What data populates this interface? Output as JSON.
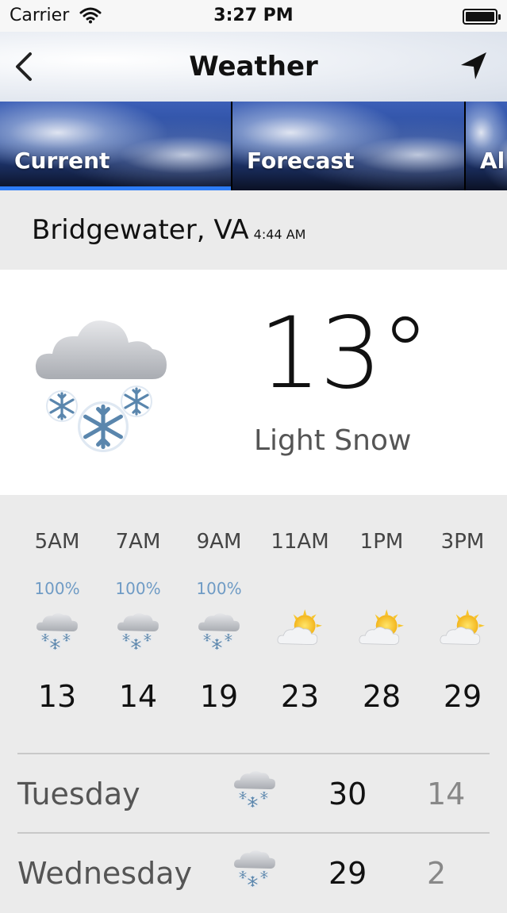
{
  "status_bar": {
    "carrier": "Carrier",
    "time": "3:27 PM"
  },
  "nav": {
    "title": "Weather",
    "back_icon": "chevron-left-icon",
    "location_icon": "location-arrow-icon"
  },
  "tabs": [
    {
      "label": "Current",
      "selected": true
    },
    {
      "label": "Forecast",
      "selected": false
    },
    {
      "label": "Al",
      "selected": false
    }
  ],
  "accent_color": "#2d7cf6",
  "location": {
    "city": "Bridgewater, VA",
    "time": "4:44 AM"
  },
  "current": {
    "temperature": "13°",
    "condition": "Light Snow",
    "icon": "snow-cloud-icon"
  },
  "hourly": [
    {
      "time": "5AM",
      "pop": "100%",
      "icon": "snow-cloud-icon",
      "temp": "13"
    },
    {
      "time": "7AM",
      "pop": "100%",
      "icon": "snow-cloud-icon",
      "temp": "14"
    },
    {
      "time": "9AM",
      "pop": "100%",
      "icon": "snow-cloud-icon",
      "temp": "19"
    },
    {
      "time": "11AM",
      "pop": "",
      "icon": "partly-sunny-icon",
      "temp": "23"
    },
    {
      "time": "1PM",
      "pop": "",
      "icon": "partly-sunny-icon",
      "temp": "28"
    },
    {
      "time": "3PM",
      "pop": "",
      "icon": "partly-sunny-icon",
      "temp": "29"
    }
  ],
  "daily": [
    {
      "day": "Tuesday",
      "icon": "snow-cloud-icon",
      "high": "30",
      "low": "14"
    },
    {
      "day": "Wednesday",
      "icon": "snow-cloud-icon",
      "high": "29",
      "low": "2"
    }
  ]
}
